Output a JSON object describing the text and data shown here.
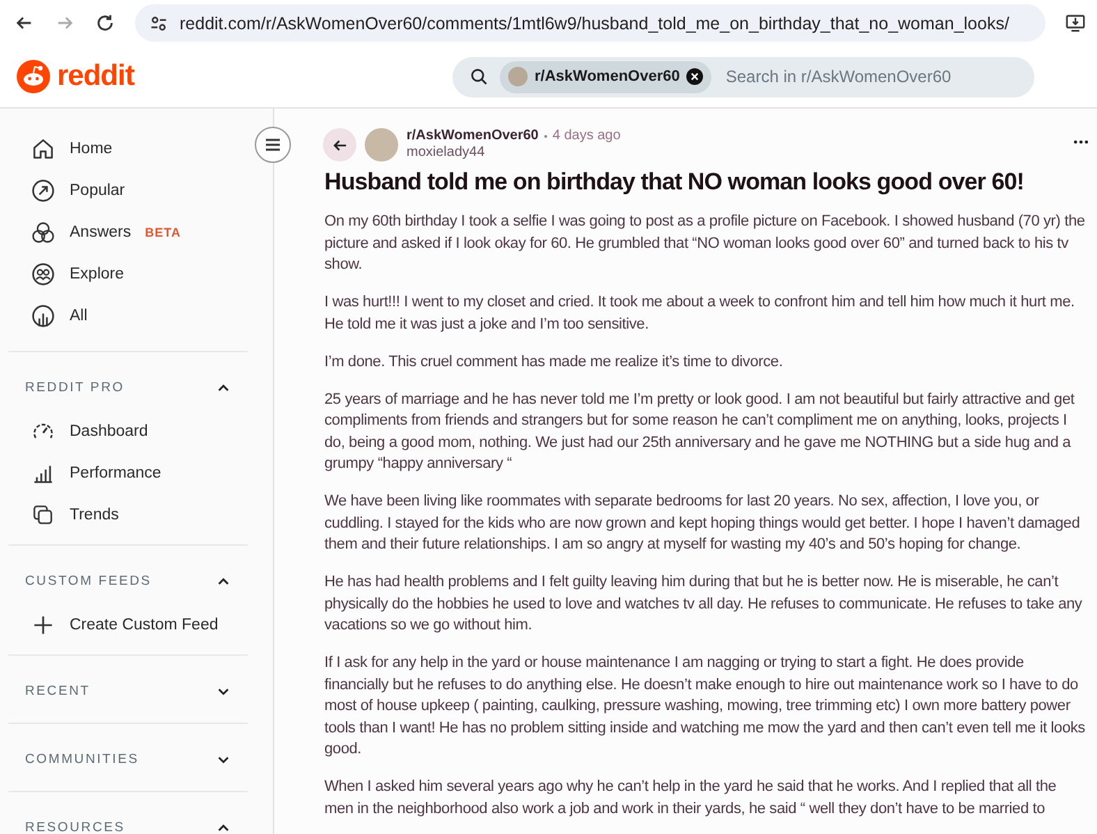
{
  "browser": {
    "url": "reddit.com/r/AskWomenOver60/comments/1mtl6w9/husband_told_me_on_birthday_that_no_woman_looks/"
  },
  "header": {
    "logo_text": "reddit",
    "search": {
      "community": "r/AskWomenOver60",
      "placeholder": "Search in r/AskWomenOver60"
    }
  },
  "sidebar": {
    "nav": [
      {
        "label": "Home"
      },
      {
        "label": "Popular"
      },
      {
        "label": "Answers",
        "badge": "BETA"
      },
      {
        "label": "Explore"
      },
      {
        "label": "All"
      }
    ],
    "sections": [
      {
        "title": "REDDIT PRO",
        "expanded": true,
        "items": [
          {
            "label": "Dashboard"
          },
          {
            "label": "Performance"
          },
          {
            "label": "Trends"
          }
        ]
      },
      {
        "title": "CUSTOM FEEDS",
        "expanded": true,
        "items": [
          {
            "label": "Create Custom Feed"
          }
        ]
      },
      {
        "title": "RECENT",
        "expanded": false
      },
      {
        "title": "COMMUNITIES",
        "expanded": false
      },
      {
        "title": "RESOURCES",
        "expanded": true
      }
    ]
  },
  "post": {
    "community": "r/AskWomenOver60",
    "time": "4 days ago",
    "author": "moxielady44",
    "title": "Husband told me on birthday that NO woman looks good over 60!",
    "paragraphs": [
      "On my 60th birthday I took a selfie I was going to post as a profile picture on Facebook. I showed husband (70 yr) the picture and asked if I look okay for 60. He grumbled that “NO woman looks good over 60” and turned back to his tv show.",
      "I was hurt!!! I went to my closet and cried. It took me about a week to confront him and tell him how much it hurt me. He told me it was just a joke and I’m too sensitive.",
      "I’m done. This cruel comment has made me realize it’s time to divorce.",
      "25 years of marriage and he has never told me I’m pretty or look good. I am not beautiful but fairly attractive and get compliments from friends and strangers but for some reason he can’t compliment me on anything, looks, projects I do, being a good mom, nothing. We just had our 25th anniversary and he gave me NOTHING but a side hug and a grumpy “happy anniversary “",
      "We have been living like roommates with separate bedrooms for last 20 years. No sex, affection, I love you, or cuddling. I stayed for the kids who are now grown and kept hoping things would get better. I hope I haven’t damaged them and their future relationships. I am so angry at myself for wasting my 40’s and 50’s hoping for change.",
      "He has had health problems and I felt guilty leaving him during that but he is better now. He is miserable, he can’t physically do the hobbies he used to love and watches tv all day. He refuses to communicate. He refuses to take any vacations so we go without him.",
      "If I ask for any help in the yard or house maintenance I am nagging or trying to start a fight. He does provide financially but he refuses to do anything else. He doesn’t make enough to hire out maintenance work so I have to do most of house upkeep ( painting, caulking, pressure washing, mowing, tree trimming etc) I own more battery power tools than I want! He has no problem sitting inside and watching me mow the yard and then can’t even tell me it looks good.",
      "When I asked him several years ago why he can’t help in the yard he said that he works. And I replied that all the men in the neighborhood also work a job and work in their yards, he said “ well they don’t have to be married to"
    ]
  }
}
